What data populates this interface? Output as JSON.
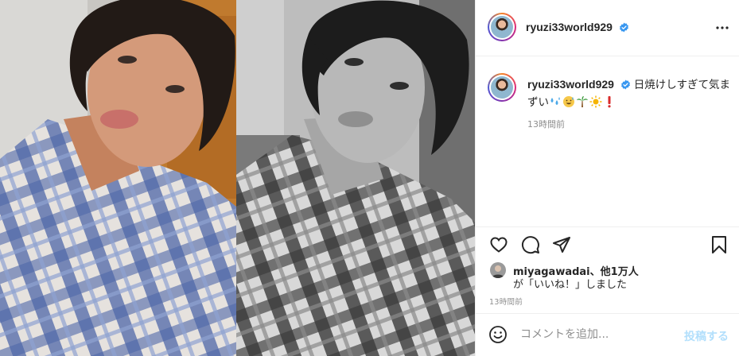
{
  "post": {
    "username": "ryuzi33world929",
    "verified": true,
    "caption": "日焼けしすぎて気まずい",
    "caption_emojis": [
      "sweat-drops-icon",
      "grinning-sweat-face-icon",
      "palm-tree-icon",
      "sun-icon",
      "exclamation-icon"
    ],
    "caption_time": "13時間前",
    "likes_user": "miyagawadai",
    "likes_others": "、他1万人",
    "likes_suffix": "が「いいね！」しました",
    "post_time": "13時間前"
  },
  "comment": {
    "placeholder": "コメントを追加...",
    "submit_label": "投稿する"
  },
  "colors": {
    "verified": "#3897f0",
    "post_button_disabled": "#b2dffc",
    "muted": "#8e8e8e"
  }
}
